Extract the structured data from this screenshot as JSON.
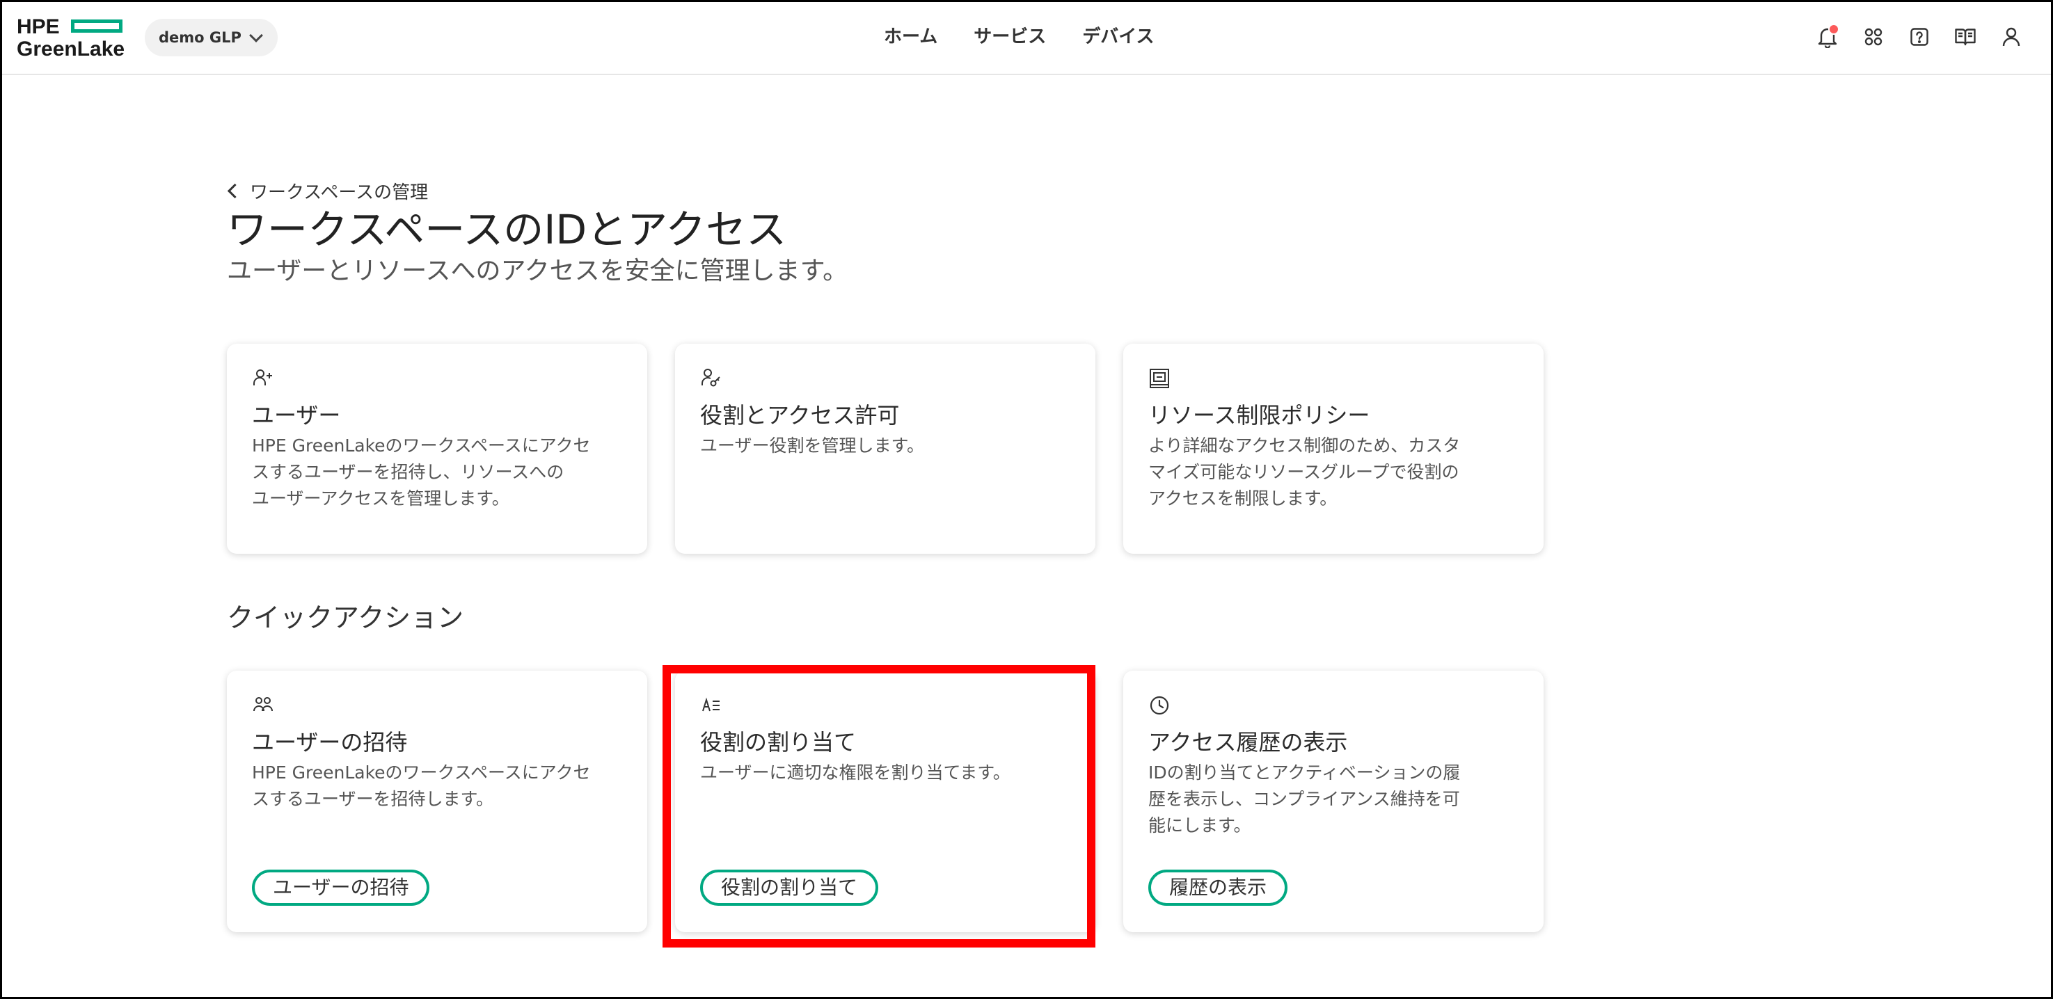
{
  "header": {
    "logo_line1": "HPE",
    "logo_line2": "GreenLake",
    "workspace": "demo GLP",
    "nav": [
      "ホーム",
      "サービス",
      "デバイス"
    ]
  },
  "page": {
    "back_label": "ワークスペースの管理",
    "title": "ワークスペースのIDとアクセス",
    "subtitle": "ユーザーとリソースへのアクセスを安全に管理します。"
  },
  "cards": [
    {
      "icon": "user-add-icon",
      "title": "ユーザー",
      "desc_lines": [
        "HPE GreenLakeのワークスペースにアクセ",
        "スするユーザーを招待し、リソースへの",
        "ユーザーアクセスを管理します。"
      ]
    },
    {
      "icon": "user-key-icon",
      "title": "役割とアクセス許可",
      "desc_lines": [
        "ユーザー役割を管理します。"
      ]
    },
    {
      "icon": "resource-policy-icon",
      "title": "リソース制限ポリシー",
      "desc_lines": [
        "より詳細なアクセス制御のため、カスタ",
        "マイズ可能なリソースグループで役割の",
        "アクセスを制限します。"
      ]
    }
  ],
  "quick_actions": {
    "title": "クイックアクション",
    "items": [
      {
        "icon": "group-icon",
        "title": "ユーザーの招待",
        "desc_lines": [
          "HPE GreenLakeのワークスペースにアクセ",
          "スするユーザーを招待します。"
        ],
        "button": "ユーザーの招待"
      },
      {
        "icon": "assign-role-icon",
        "title": "役割の割り当て",
        "desc_lines": [
          "ユーザーに適切な権限を割り当てます。"
        ],
        "button": "役割の割り当て"
      },
      {
        "icon": "clock-icon",
        "title": "アクセス履歴の表示",
        "desc_lines": [
          "IDの割り当てとアクティベーションの履",
          "歴を表示し、コンプライアンス維持を可",
          "能にします。"
        ],
        "button": "履歴の表示"
      }
    ]
  },
  "colors": {
    "accent": "#01a982",
    "highlight": "#ff0000",
    "notification": "#fc5a5a"
  }
}
